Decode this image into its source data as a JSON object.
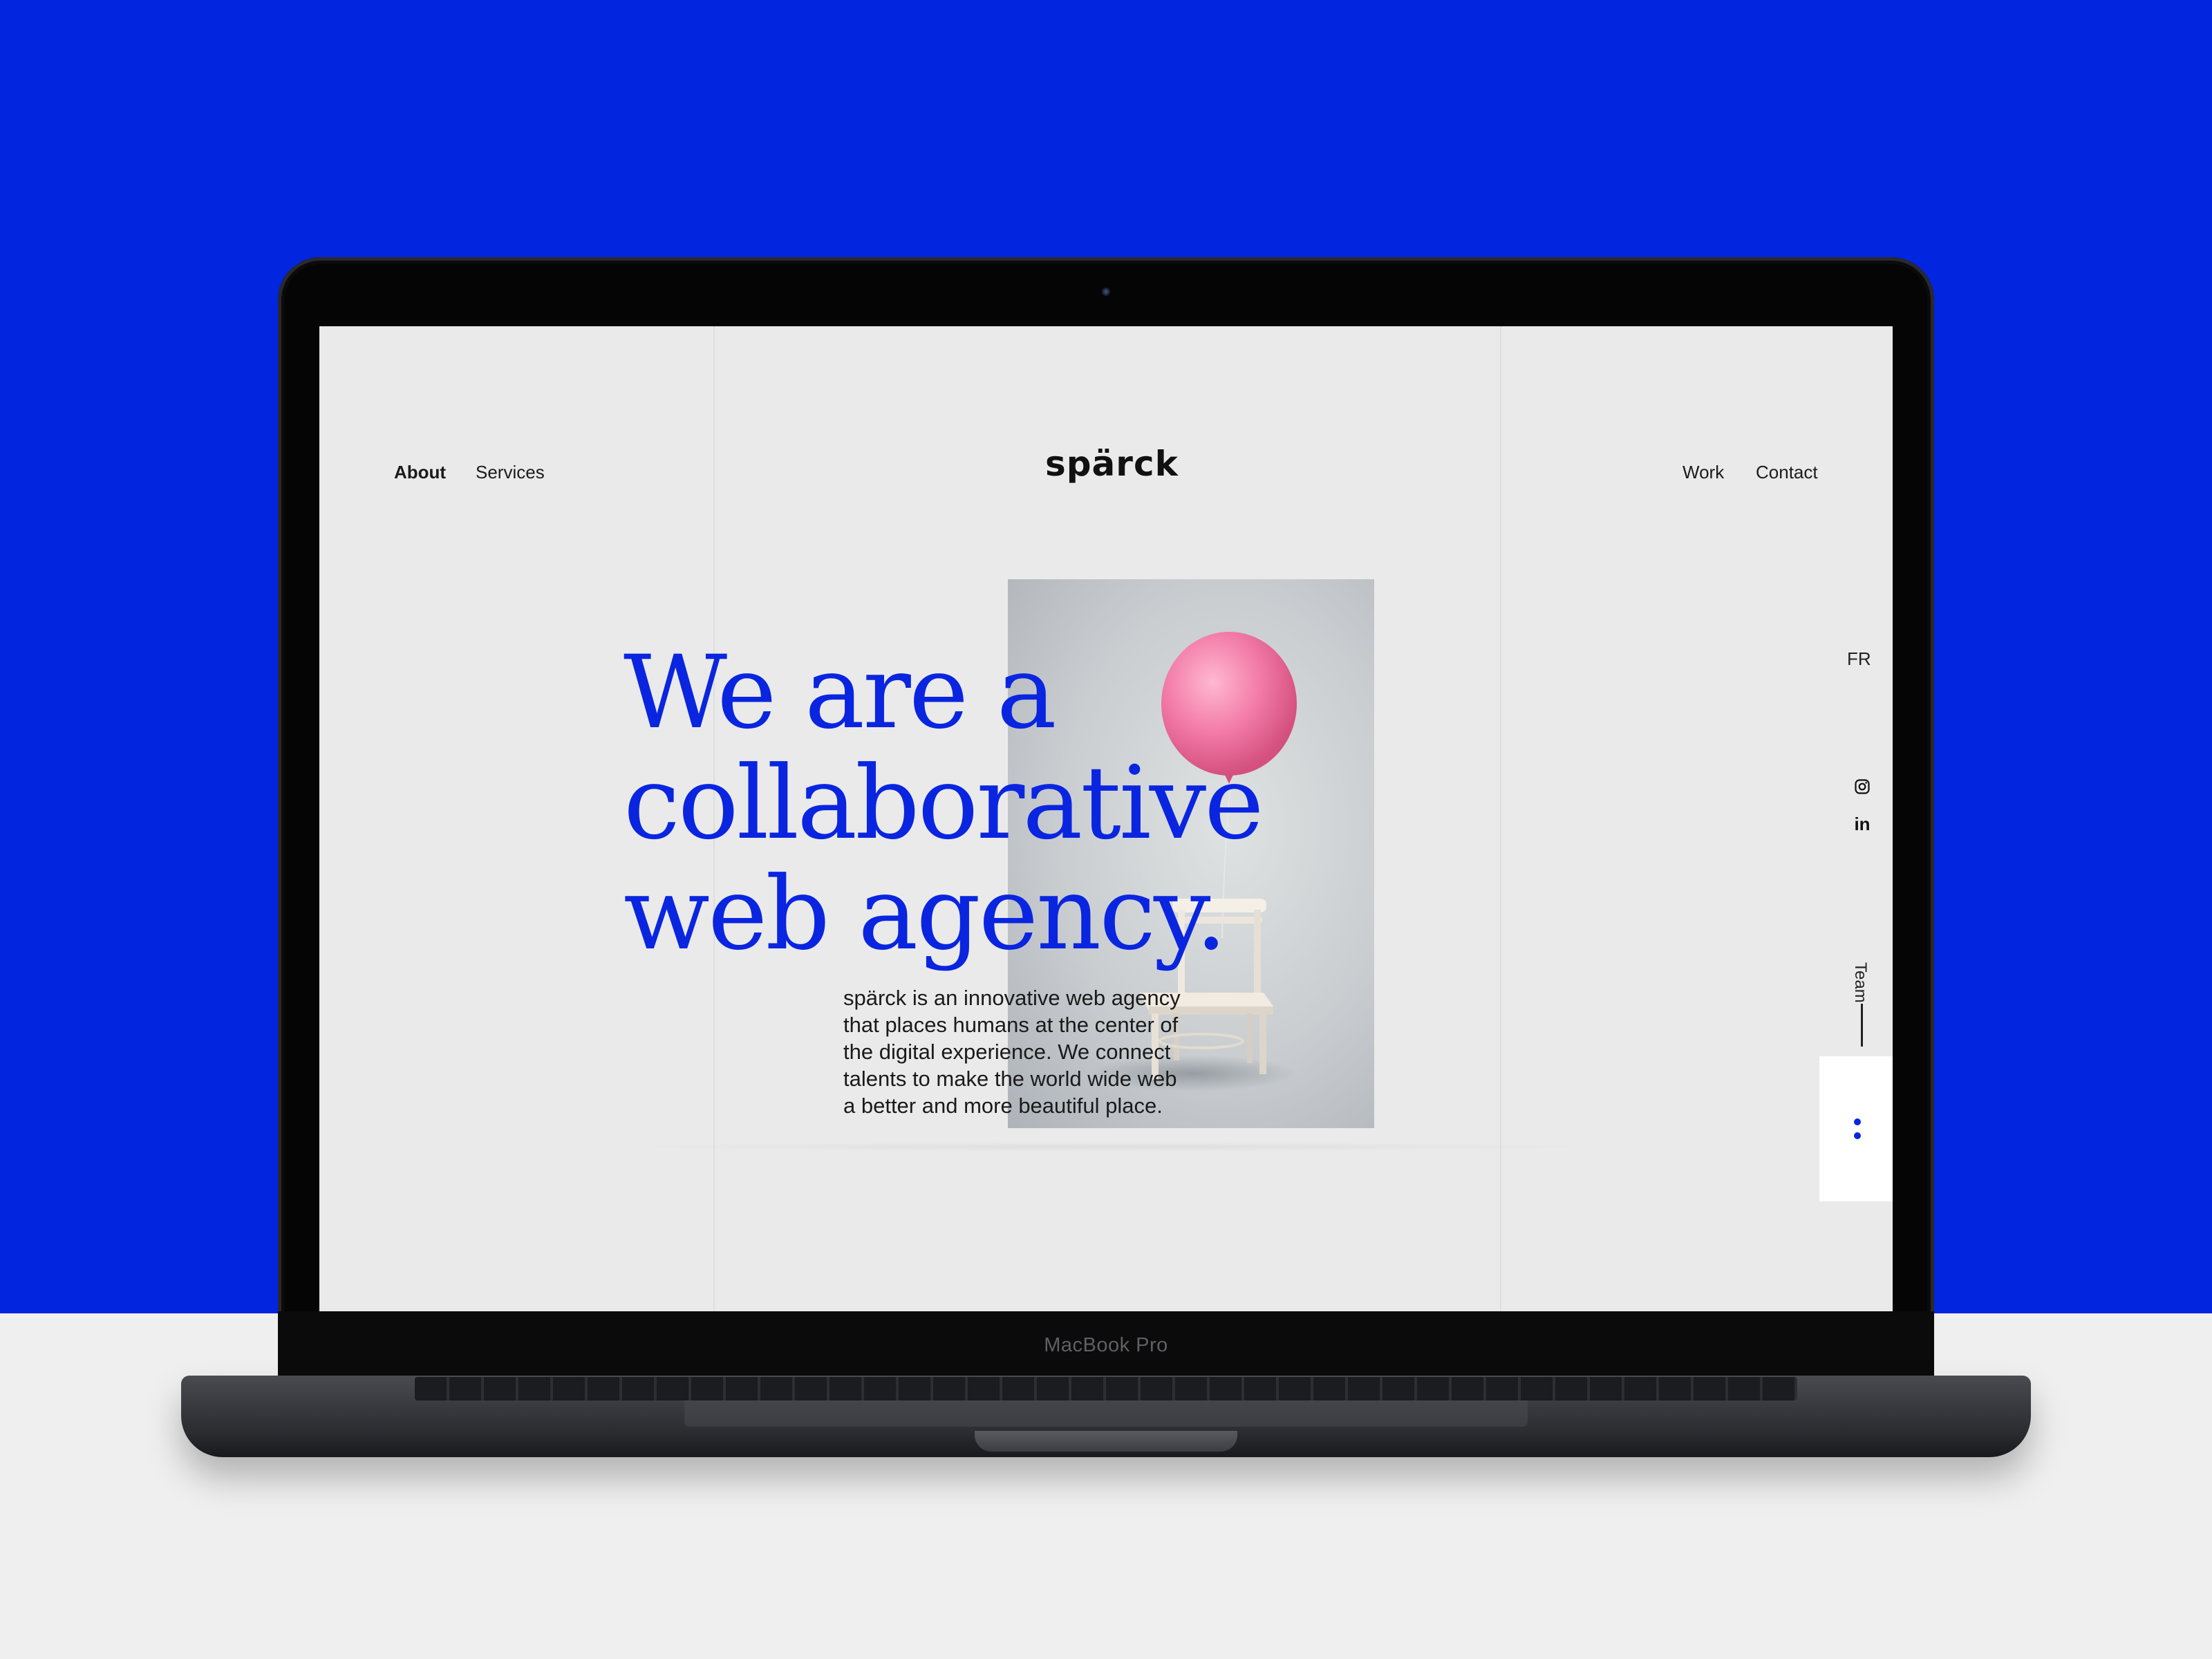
{
  "device": {
    "label": "MacBook Pro"
  },
  "nav": {
    "left": [
      {
        "label": "About",
        "active": true
      },
      {
        "label": "Services",
        "active": false
      }
    ],
    "right": [
      {
        "label": "Work"
      },
      {
        "label": "Contact"
      }
    ]
  },
  "logo": {
    "text": "spärck"
  },
  "hero": {
    "headline_lines": [
      "We are a",
      "collaborative",
      "web agency."
    ],
    "description_lines": [
      "spärck is an innovative web agency",
      "that places humans at the center of",
      "the digital experience. We connect",
      "talents to make the world wide web",
      "a better and more beautiful place."
    ]
  },
  "rail": {
    "language": "FR",
    "social_icons": [
      "instagram-icon",
      "linkedin-icon"
    ],
    "linkedin_text": "in",
    "section_label": "Team"
  },
  "colors": {
    "accent": "#0a25e0",
    "background_blue": "#0225e0",
    "screen_bg": "#eaeaea",
    "balloon": "#f27aa6"
  }
}
